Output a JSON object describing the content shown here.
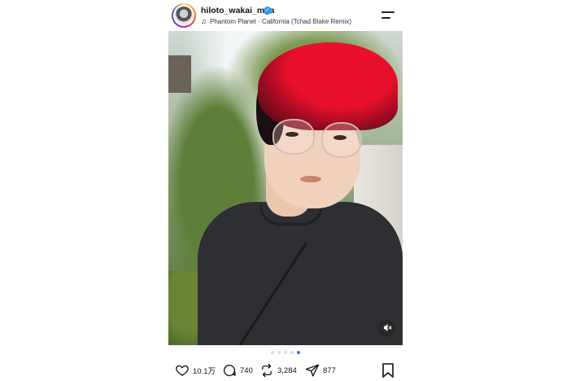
{
  "post": {
    "username": "hiloto_wakai_mga",
    "verified": true,
    "song": "Phantom Planet · California (Tchad Blake Remix)",
    "carousel": {
      "total": 5,
      "active_index": 4
    },
    "actions": {
      "likes": "10.1万",
      "comments": "740",
      "reposts": "3,284",
      "shares": "877"
    }
  },
  "icons": {
    "verified": "verified-badge-icon",
    "music": "music-note-icon",
    "menu": "menu-icon",
    "mute": "speaker-muted-icon",
    "like": "heart-icon",
    "comment": "comment-bubble-icon",
    "repost": "repost-icon",
    "share": "paper-plane-icon",
    "save": "bookmark-icon"
  },
  "colors": {
    "verified": "#3897f0",
    "active_dot": "#3a6ef0",
    "text": "#111111"
  }
}
